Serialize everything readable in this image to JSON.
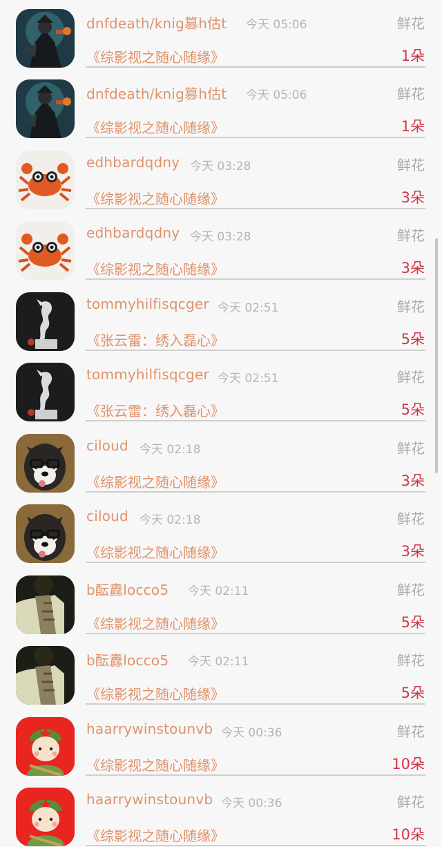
{
  "colors": {
    "name": "#e0926a",
    "time": "#b5b5b5",
    "type": "#a9a9a9",
    "count": "#d0364a"
  },
  "gifts": [
    {
      "user": "dnfdeath/knig篡h估t",
      "time": "今天 05:06",
      "type": "鲜花",
      "title": "《综影视之随心随缘》",
      "count": "1朵",
      "avatar_icon": "dark-knight-avatar-icon"
    },
    {
      "user": "dnfdeath/knig篡h估t",
      "time": "今天 05:06",
      "type": "鲜花",
      "title": "《综影视之随心随缘》",
      "count": "1朵",
      "avatar_icon": "dark-knight-avatar-icon"
    },
    {
      "user": "edhbardqdny",
      "time": "今天 03:28",
      "type": "鲜花",
      "title": "《综影视之随心随缘》",
      "count": "3朵",
      "avatar_icon": "crab-avatar-icon"
    },
    {
      "user": "edhbardqdny",
      "time": "今天 03:28",
      "type": "鲜花",
      "title": "《综影视之随心随缘》",
      "count": "3朵",
      "avatar_icon": "crab-avatar-icon"
    },
    {
      "user": "tommyhilfisqcger",
      "time": "今天 02:51",
      "type": "鲜花",
      "title": "《张云雷：绣入磊心》",
      "count": "5朵",
      "avatar_icon": "glass-horse-avatar-icon"
    },
    {
      "user": "tommyhilfisqcger",
      "time": "今天 02:51",
      "type": "鲜花",
      "title": "《张云雷：绣入磊心》",
      "count": "5朵",
      "avatar_icon": "glass-horse-avatar-icon"
    },
    {
      "user": "ciloud",
      "time": "今天 02:18",
      "type": "鲜花",
      "title": "《综影视之随心随缘》",
      "count": "3朵",
      "avatar_icon": "husky-glasses-avatar-icon"
    },
    {
      "user": "ciloud",
      "time": "今天 02:18",
      "type": "鲜花",
      "title": "《综影视之随心随缘》",
      "count": "3朵",
      "avatar_icon": "husky-glasses-avatar-icon"
    },
    {
      "user": "b酝纛locco5",
      "time": "今天 02:11",
      "type": "鲜花",
      "title": "《综影视之随心随缘》",
      "count": "5朵",
      "avatar_icon": "scarf-person-avatar-icon"
    },
    {
      "user": "b酝纛locco5",
      "time": "今天 02:11",
      "type": "鲜花",
      "title": "《综影视之随心随缘》",
      "count": "5朵",
      "avatar_icon": "scarf-person-avatar-icon"
    },
    {
      "user": "haarrywinstounvb",
      "time": "今天 00:36",
      "type": "鲜花",
      "title": "《综影视之随心随缘》",
      "count": "10朵",
      "avatar_icon": "cartoon-soldier-avatar-icon"
    },
    {
      "user": "haarrywinstounvb",
      "time": "今天 00:36",
      "type": "鲜花",
      "title": "《综影视之随心随缘》",
      "count": "10朵",
      "avatar_icon": "cartoon-soldier-avatar-icon"
    }
  ]
}
